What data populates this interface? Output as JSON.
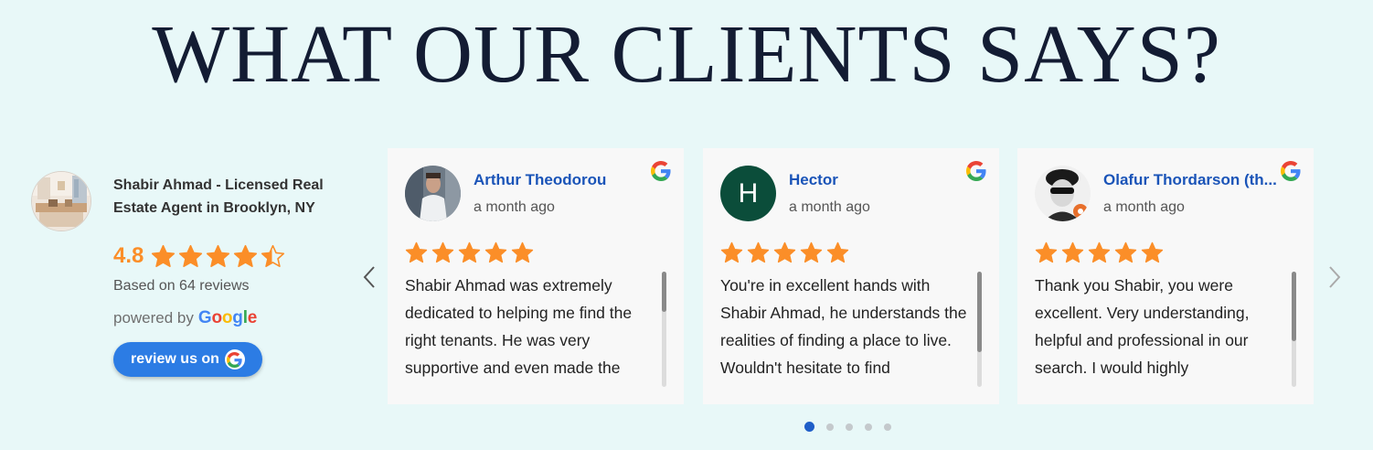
{
  "heading": "WHAT OUR CLIENTS SAYS?",
  "business": {
    "name": "Shabir Ahmad - Licensed Real Estate Agent in Brooklyn, NY",
    "rating": "4.8",
    "stars": 4.8,
    "review_count": "Based on 64 reviews",
    "powered_by": "powered by",
    "google_letters": [
      "G",
      "o",
      "o",
      "g",
      "l",
      "e"
    ],
    "review_button": "review us on"
  },
  "colors": {
    "star": "#fb8e28",
    "name": "#1a54b8",
    "button": "#2c7ce4",
    "active_dot": "#1f5ec8",
    "google": [
      "#4285F4",
      "#EA4335",
      "#FBBC05",
      "#4285F4",
      "#34A853",
      "#EA4335"
    ]
  },
  "reviews": [
    {
      "name": "Arthur Theodorou",
      "time": "a month ago",
      "stars": 5,
      "avatar": "photo",
      "text": "Shabir Ahmad was extremely dedicated to helping me find the right tenants. He was very supportive and even made the"
    },
    {
      "name": "Hector",
      "time": "a month ago",
      "stars": 5,
      "avatar": "initial",
      "initial": "H",
      "text": "You're in excellent hands with Shabir Ahmad, he understands the realities of finding a place to live. Wouldn't hesitate to find"
    },
    {
      "name": "Olafur Thordarson (th...",
      "time": "a month ago",
      "stars": 5,
      "avatar": "photo",
      "text": "Thank you Shabir, you were excellent. Very understanding, helpful and professional in our search. I would highly"
    }
  ],
  "pagination": {
    "count": 5,
    "active": 0
  },
  "icons": {
    "prev": "chevron-left-icon",
    "next": "chevron-right-icon",
    "google": "google-g-icon",
    "star": "star-icon"
  }
}
